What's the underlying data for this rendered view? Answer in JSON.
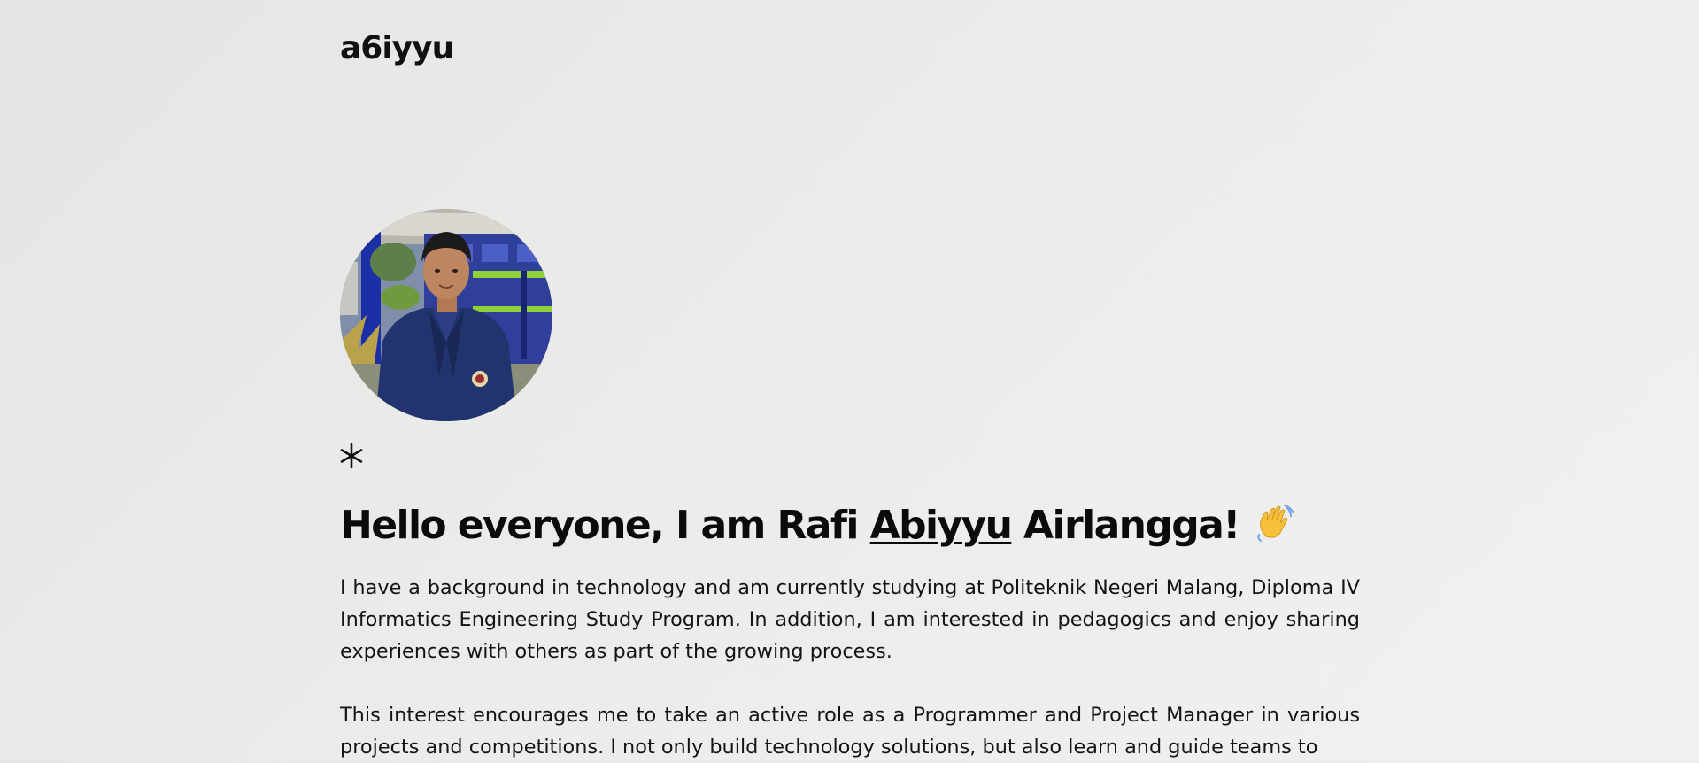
{
  "header": {
    "logo_text": "a6iyyu"
  },
  "hero": {
    "avatar_alt": "portrait photo",
    "asterisk_icon": "asterisk-icon",
    "headline": {
      "before": "Hello everyone, I am Rafi ",
      "underlined": "Abiyyu",
      "after": " Airlangga!",
      "emoji": "waving-hand-icon"
    },
    "paragraphs": [
      "I have a background in technology and am currently studying at Politeknik Negeri Malang, Diploma IV Informatics Engineering Study Program. In addition, I am interested in pedagogics and enjoy sharing experiences with others as part of the growing process.",
      "This interest encourages me to take an active role as a Programmer and Project Manager in various projects and competitions. I not only build technology solutions, but also learn and guide teams to"
    ]
  },
  "colors": {
    "background": "#ebebe9",
    "text": "#0b0b0b",
    "jacket": "#1f2f66"
  }
}
